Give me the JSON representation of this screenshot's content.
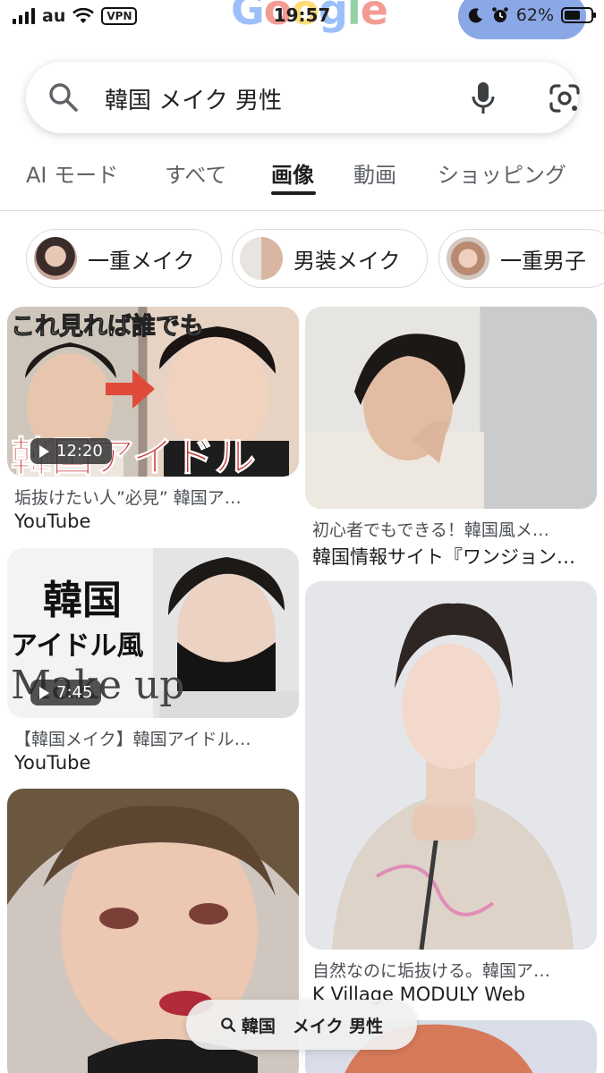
{
  "status_bar": {
    "carrier": "au",
    "vpn": "VPN",
    "time": "19:57",
    "battery": "62%",
    "battery_level": 0.62
  },
  "logo": {
    "letters": [
      "G",
      "o",
      "o",
      "g",
      "l",
      "e"
    ]
  },
  "search": {
    "query": "韓国 メイク 男性",
    "icons": [
      "search-icon",
      "mic-icon",
      "lens-icon"
    ]
  },
  "tabs": [
    {
      "label": "AI モード",
      "active": false
    },
    {
      "label": "すべて",
      "active": false
    },
    {
      "label": "画像",
      "active": true
    },
    {
      "label": "動画",
      "active": false
    },
    {
      "label": "ショッピング",
      "active": false
    }
  ],
  "chips": [
    {
      "label": "一重メイク"
    },
    {
      "label": "男装メイク"
    },
    {
      "label": "一重男子"
    }
  ],
  "results": [
    {
      "caption": "垢抜けたい人”必見” 韓国ア…",
      "source": "YouTube",
      "duration": "12:20",
      "overlay_top": "これ見れば誰でも",
      "overlay_bottom": "韓国アイドル"
    },
    {
      "caption": "初心者でもできる！韓国風メ…",
      "source": "韓国情報サイト『ワンジョン…"
    },
    {
      "caption": "【韓国メイク】韓国アイドル…",
      "source": "YouTube",
      "duration": "7:45",
      "overlay_top": "韓国",
      "overlay_mid": "アイドル風",
      "overlay_bottom": "Make up"
    },
    {
      "caption": "自然なのに垢抜ける。韓国ア…",
      "source": "K Village MODULY Web"
    },
    {},
    {}
  ],
  "floating_search": {
    "label": "韓国　メイク 男性"
  }
}
